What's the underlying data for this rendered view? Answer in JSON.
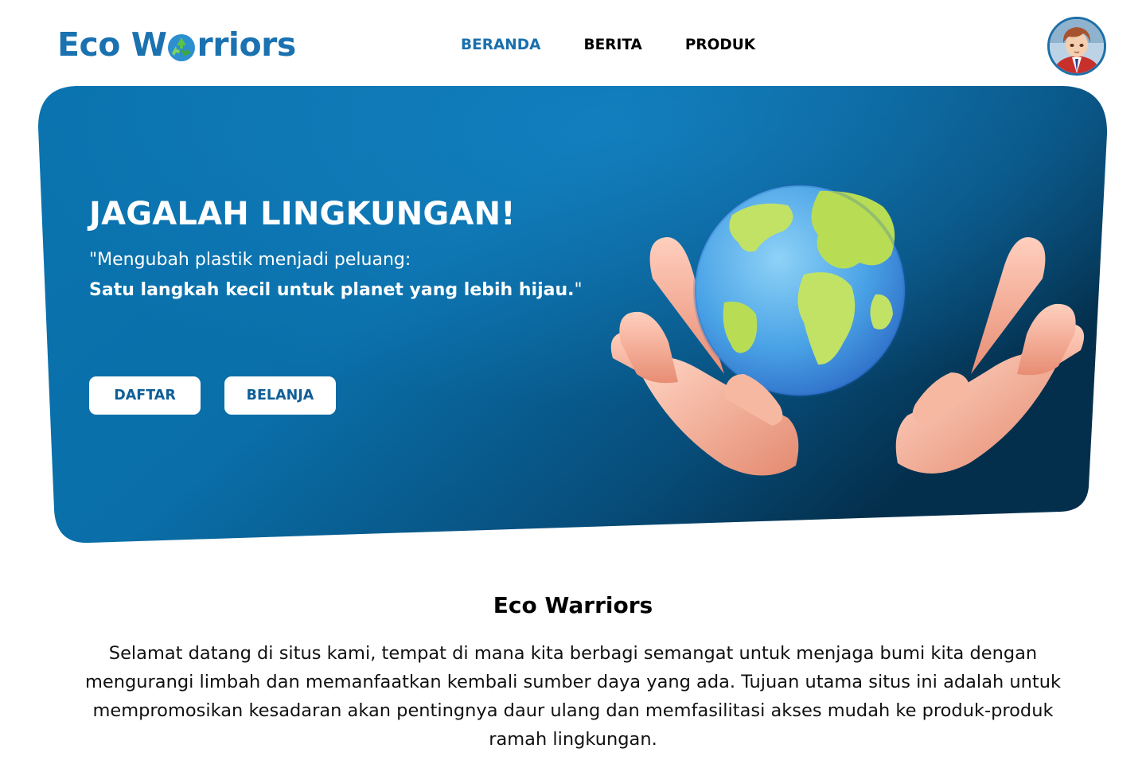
{
  "brand": {
    "logo_text_start": "Eco W",
    "logo_text_end": "rriors",
    "logo_icon": "recycle-icon",
    "color": "#1b72b0"
  },
  "nav": {
    "items": [
      {
        "label": "BERANDA",
        "active": true
      },
      {
        "label": "BERITA",
        "active": false
      },
      {
        "label": "PRODUK",
        "active": false
      }
    ],
    "active_color": "#1a70ad"
  },
  "user": {
    "avatar_icon": "user-avatar"
  },
  "hero": {
    "title": "JAGALAH LINGKUNGAN!",
    "quote_line1": "\"Mengubah plastik menjadi peluang:",
    "quote_line2": "Satu langkah kecil untuk planet yang lebih hijau.",
    "quote_line2_end": "\"",
    "buttons": {
      "register": "DAFTAR",
      "shop": "BELANJA"
    },
    "image_icon": "hands-holding-globe-illustration",
    "bg_color_light": "#0a7ab8",
    "bg_color_dark": "#053a5c"
  },
  "about": {
    "title": "Eco Warriors",
    "text": "Selamat datang di situs kami, tempat di mana kita berbagi semangat untuk menjaga bumi kita dengan mengurangi limbah dan memanfaatkan kembali sumber daya yang ada. Tujuan utama situs ini adalah untuk mempromosikan kesadaran akan pentingnya daur ulang dan memfasilitasi akses mudah ke produk-produk ramah lingkungan."
  }
}
